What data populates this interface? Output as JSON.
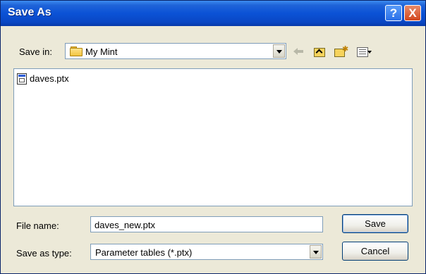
{
  "window": {
    "title": "Save As",
    "help_glyph": "?",
    "close_glyph": "X"
  },
  "save_in": {
    "label": "Save in:",
    "value": "My Mint",
    "icon": "folder-icon"
  },
  "toolbar": {
    "back_icon": "back-arrow-icon",
    "up_icon": "up-one-level-icon",
    "new_folder_icon": "new-folder-icon",
    "view_menu_icon": "view-menu-icon"
  },
  "files": [
    {
      "name": "daves.ptx",
      "icon": "ptx-file-icon"
    }
  ],
  "file_name": {
    "label": "File name:",
    "value": "daves_new.ptx"
  },
  "save_as_type": {
    "label": "Save as type:",
    "value": "Parameter tables (*.ptx)"
  },
  "buttons": {
    "save": "Save",
    "cancel": "Cancel"
  },
  "colors": {
    "titlebar": "#0b52d6",
    "dialog_bg": "#ece9d8",
    "close_button": "#d2461c"
  }
}
